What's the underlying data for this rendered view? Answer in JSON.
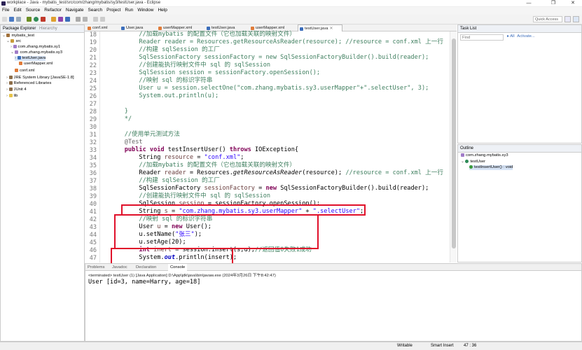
{
  "window": {
    "title": "workplace - Java - mybatis_test/src/com/zhang/mybatis/sy3/testUser.java - Eclipse",
    "minimize": "—",
    "maximize": "❐",
    "close": "✕"
  },
  "menu": [
    "File",
    "Edit",
    "Source",
    "Refactor",
    "Navigate",
    "Search",
    "Project",
    "Run",
    "Window",
    "Help"
  ],
  "toolbar": {
    "quick_access": "Quick Access"
  },
  "package_explorer": {
    "title": "Package Explorer",
    "tab2": "Hierarchy",
    "items": [
      {
        "label": "mybatis_test",
        "icon": "project-icon"
      },
      {
        "label": "src",
        "icon": "source-folder-icon"
      },
      {
        "label": "com.zhang.mybatis.sy1",
        "icon": "package-icon"
      },
      {
        "label": "com.zhang.mybatis.sy3",
        "icon": "package-icon"
      },
      {
        "label": "testUser.java",
        "icon": "java-file-icon"
      },
      {
        "label": "userMapper.xml",
        "icon": "xml-file-icon"
      },
      {
        "label": "conf.xml",
        "icon": "xml-file-icon"
      },
      {
        "label": "JRE System Library [JavaSE-1.8]",
        "icon": "library-icon"
      },
      {
        "label": "Referenced Libraries",
        "icon": "library-icon"
      },
      {
        "label": "JUnit 4",
        "icon": "library-icon"
      },
      {
        "label": "lib",
        "icon": "folder-icon"
      }
    ]
  },
  "editor": {
    "tabs": [
      {
        "label": "conf.xml",
        "icon": "xml-file-icon"
      },
      {
        "label": "User.java",
        "icon": "java-file-icon"
      },
      {
        "label": "userMapper.xml",
        "icon": "xml-file-icon"
      },
      {
        "label": "testUser.java",
        "icon": "java-file-icon"
      },
      {
        "label": "userMapper.xml",
        "icon": "xml-file-icon"
      },
      {
        "label": "testUser.java",
        "icon": "java-file-icon",
        "active": true
      }
    ],
    "line_numbers": [
      "18",
      "19",
      "20",
      "21",
      "22",
      "23",
      "24",
      "25",
      "26",
      "27",
      "28",
      "29",
      "30",
      "31",
      "32",
      "33",
      "34",
      "35",
      "36",
      "37",
      "38",
      "39",
      "40",
      "41",
      "42",
      "43",
      "44",
      "45",
      "46",
      "47"
    ],
    "lines": [
      [
        [
          "cm",
          "        //加载mybatis 的配置文件（它也加载关联的映射文件）"
        ]
      ],
      [
        [
          "cm",
          "        Reader reader = Resources.getResourceAsReader(resource); //resource = conf.xml 上一行"
        ]
      ],
      [
        [
          "cm",
          "        //构建 sqlSession 的工厂"
        ]
      ],
      [
        [
          "cm",
          "        SqlSessionFactory sessionFactory = new SqlSessionFactoryBuilder().build(reader);"
        ]
      ],
      [
        [
          "cm",
          "        //创建能执行映射文件中 sql 的 sqlSession"
        ]
      ],
      [
        [
          "cm",
          "        SqlSession session = sessionFactory.openSession();"
        ]
      ],
      [
        [
          "cm",
          "        //映射 sql 的标识字符串"
        ]
      ],
      [
        [
          "cm",
          "        User u = session.selectOne(\"com.zhang.mybatis.sy3.userMapper\"+\".selectUser\", 3);"
        ]
      ],
      [
        [
          "cm",
          "        System.out.println(u);"
        ]
      ],
      [
        [
          "cm",
          ""
        ]
      ],
      [
        [
          "cm",
          "    }"
        ]
      ],
      [
        [
          "cm",
          "    */"
        ]
      ],
      [
        [
          "",
          ""
        ]
      ],
      [
        [
          "cm",
          "    //使用单元测试方法"
        ]
      ],
      [
        [
          "ann",
          "    @Test"
        ]
      ],
      [
        [
          "kw",
          "    public void "
        ],
        [
          "",
          "testInsertUser() "
        ],
        [
          "kw",
          "throws "
        ],
        [
          "",
          "IOException{"
        ]
      ],
      [
        [
          "",
          "        String "
        ],
        [
          "vr",
          "resource"
        ],
        [
          "",
          " = "
        ],
        [
          "st",
          "\"conf.xml\""
        ],
        [
          "",
          ";"
        ]
      ],
      [
        [
          "cm",
          "        //加载mybatis 的配置文件（它也加载关联的映射文件）"
        ]
      ],
      [
        [
          "",
          "        Reader "
        ],
        [
          "vr",
          "reader"
        ],
        [
          "",
          " = Resources."
        ],
        [
          "it",
          "getResourceAsReader"
        ],
        [
          "",
          "(resource); "
        ],
        [
          "cm",
          "//resource = conf.xml 上一行"
        ]
      ],
      [
        [
          "cm",
          "        //构建 sqlSession 的工厂"
        ]
      ],
      [
        [
          "",
          "        SqlSessionFactory "
        ],
        [
          "vr",
          "sessionFactory"
        ],
        [
          "",
          " = "
        ],
        [
          "kw",
          "new "
        ],
        [
          "",
          "SqlSessionFactoryBuilder().build(reader);"
        ]
      ],
      [
        [
          "cm",
          "        //创建能执行映射文件中 sql 的 sqlSession"
        ]
      ],
      [
        [
          "",
          "        SqlSession "
        ],
        [
          "vr",
          "session"
        ],
        [
          "",
          " = sessionFactory.openSession();"
        ]
      ],
      [
        [
          "",
          "        String "
        ],
        [
          "vr",
          "s"
        ],
        [
          "",
          " = "
        ],
        [
          "st",
          "\"com.zhang.mybatis.sy3.userMapper\""
        ],
        [
          "",
          " + "
        ],
        [
          "st",
          "\".selectUser\""
        ],
        [
          "",
          ";"
        ]
      ],
      [
        [
          "cm",
          "        //映射 sql 的标识字符串"
        ]
      ],
      [
        [
          "",
          "        User "
        ],
        [
          "vr",
          "u"
        ],
        [
          "",
          " = "
        ],
        [
          "kw",
          "new "
        ],
        [
          "",
          "User();"
        ]
      ],
      [
        [
          "",
          "        u.setName("
        ],
        [
          "st",
          "\"张三\""
        ],
        [
          "",
          ");"
        ]
      ],
      [
        [
          "",
          "        u.setAge(20);"
        ]
      ],
      [
        [
          "kw",
          "        int "
        ],
        [
          "vr",
          "inert"
        ],
        [
          "",
          " = session.insert(s,u);"
        ],
        [
          "cm",
          "//返回值0失败1成功"
        ]
      ],
      [
        [
          "",
          "        System."
        ],
        [
          "fld",
          "out"
        ],
        [
          "",
          ".println(insert);"
        ]
      ]
    ]
  },
  "task_list": {
    "title": "Task List",
    "find_placeholder": "Find",
    "all": "All",
    "activate": "Activate..."
  },
  "outline": {
    "title": "Outline",
    "items": [
      {
        "label": "com.zhang.mybatis.sy3",
        "icon": "package-icon"
      },
      {
        "label": "testUser",
        "icon": "class-icon"
      },
      {
        "label": "testInsertUser() : void",
        "icon": "method-icon"
      }
    ]
  },
  "console": {
    "tabs": [
      "Problems",
      "Javadoc",
      "Declaration",
      "Console"
    ],
    "info": "<terminated> testUser (1) [Java Application] D:\\App\\jdk\\java\\bin\\javaw.exe (2024年3月26日 下午8:42:47)",
    "output": "User [id=3, name=Harry, age=18]"
  },
  "status": {
    "writable": "Writable",
    "insert_mode": "Smart Insert",
    "position": "47 : 36"
  },
  "colors": {
    "highlight_box": "#e0102a",
    "keyword": "#7f0055",
    "comment": "#3f7f5f",
    "string": "#2a00ff"
  }
}
